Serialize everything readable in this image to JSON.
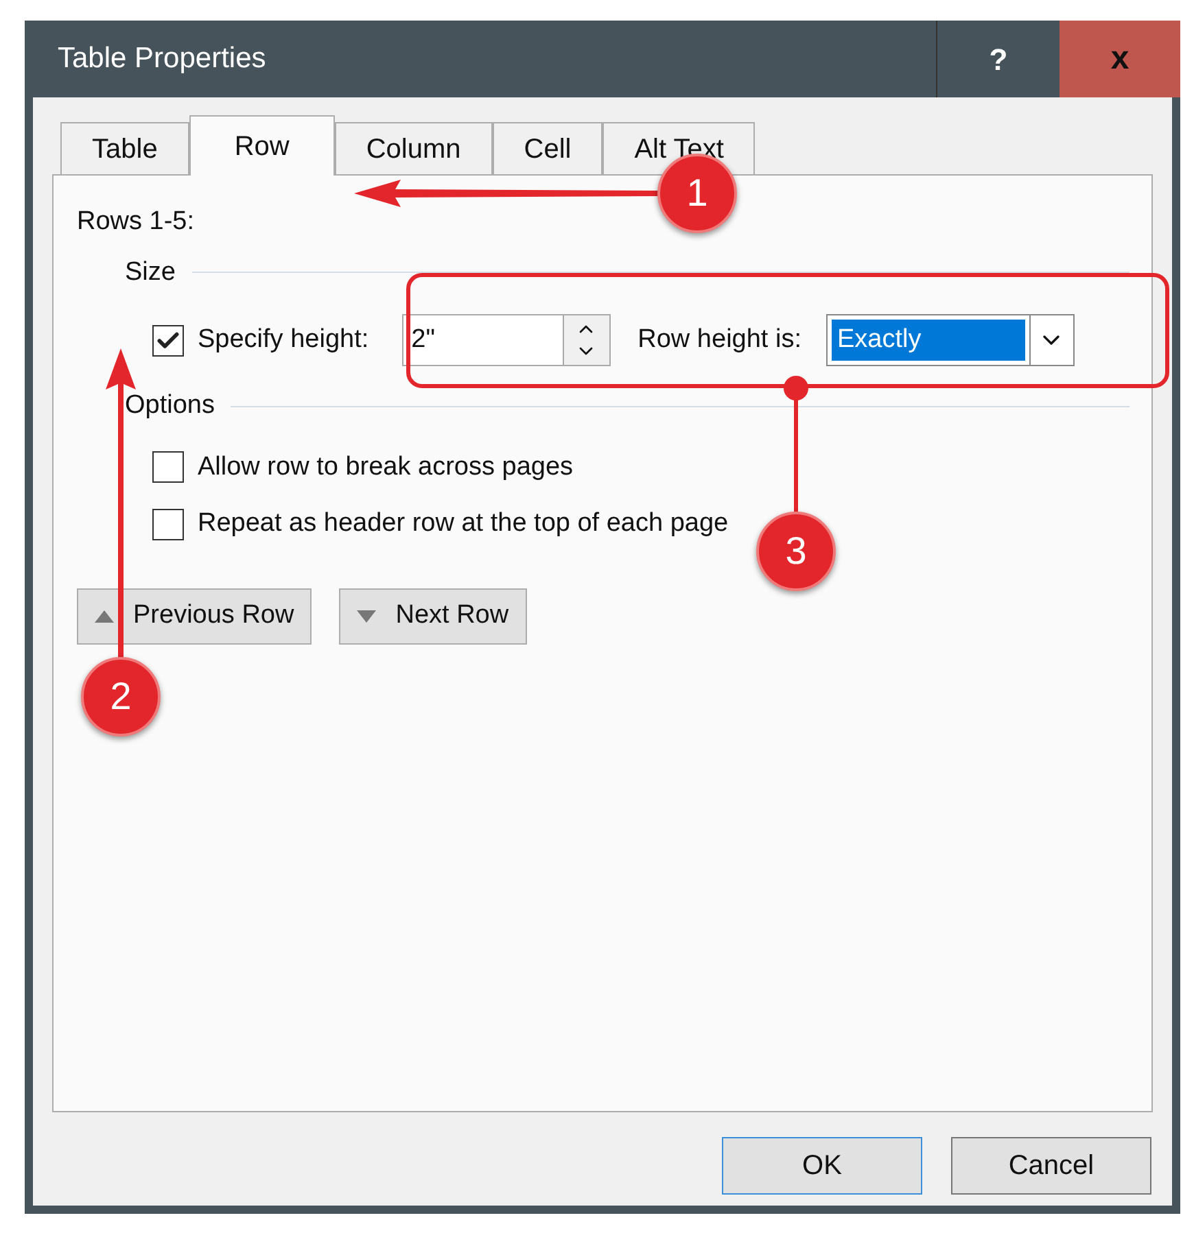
{
  "window": {
    "title": "Table Properties",
    "help_button": "?",
    "close_button": "x"
  },
  "tabs": [
    {
      "label": "Table",
      "selected": false
    },
    {
      "label": "Row",
      "selected": true
    },
    {
      "label": "Column",
      "selected": false
    },
    {
      "label": "Cell",
      "selected": false
    },
    {
      "label": "Alt Text",
      "selected": false
    }
  ],
  "panel": {
    "heading": "Rows 1-5:",
    "size_group": {
      "title": "Size",
      "specify_height": {
        "label": "Specify height:",
        "checked": true
      },
      "height_field": {
        "value": "2\""
      },
      "row_height_label": "Row height is:",
      "row_height_select": {
        "value": "Exactly"
      }
    },
    "options_group": {
      "title": "Options",
      "options": [
        {
          "label": "Allow row to break across pages",
          "checked": false
        },
        {
          "label": "Repeat as header row at the top of each page",
          "checked": false
        }
      ]
    },
    "nav_buttons": [
      {
        "label": "Previous Row",
        "kind": "previous"
      },
      {
        "label": "Next Row",
        "kind": "next"
      }
    ]
  },
  "buttons": [
    "OK",
    "Cancel"
  ],
  "callouts": [
    {
      "number": "1"
    },
    {
      "number": "2"
    },
    {
      "number": "3"
    }
  ]
}
